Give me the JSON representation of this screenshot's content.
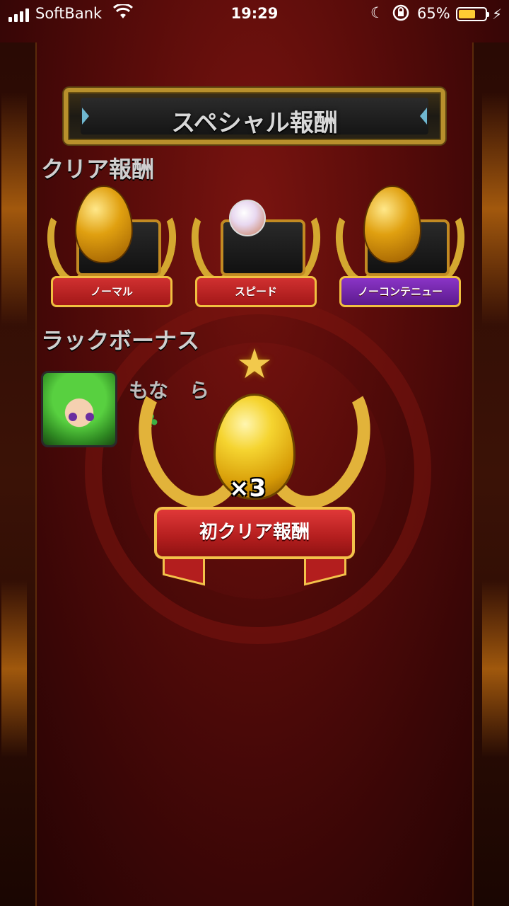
{
  "status_bar": {
    "carrier": "SoftBank",
    "time": "19:29",
    "battery_percent": "65%",
    "battery_level": 0.65
  },
  "header": {
    "title": "スペシャル報酬"
  },
  "clear_rewards": {
    "label": "クリア報酬",
    "items": [
      {
        "label": "ノーマル",
        "icon": "golden-egg-chest-icon"
      },
      {
        "label": "スピード",
        "icon": "orb-chest-icon"
      },
      {
        "label": "ノーコンテニュー",
        "icon": "golden-egg-chest-icon"
      }
    ]
  },
  "luck_bonus": {
    "label": "ラックボーナス",
    "monster_name": "もな",
    "name_suffix": "ら"
  },
  "popup": {
    "count": "×3",
    "ribbon_label": "初クリア報酬"
  },
  "colors": {
    "background": "#5a0c0a",
    "gold": "#e2b33a",
    "ribbon_red": "#b31e1e",
    "ribbon_purple": "#5c1a8e"
  }
}
